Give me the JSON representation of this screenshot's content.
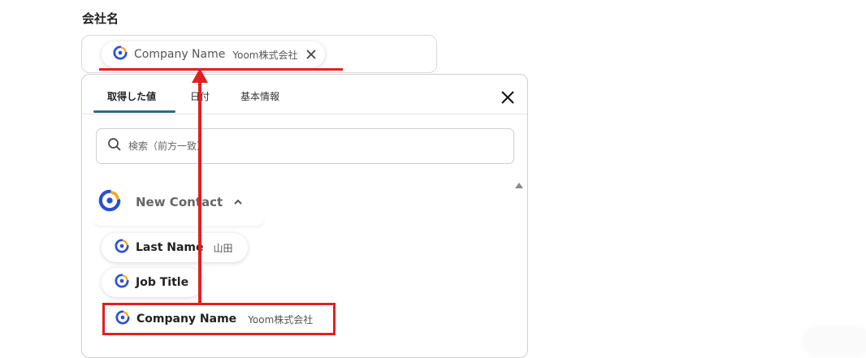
{
  "field": {
    "label": "会社名",
    "selected_chip": {
      "name": "Company Name",
      "value": "Yoom株式会社"
    }
  },
  "panel": {
    "tabs": [
      {
        "label": "取得した値",
        "active": true
      },
      {
        "label": "日付",
        "active": false
      },
      {
        "label": "基本情報",
        "active": false
      }
    ],
    "search_placeholder": "検索（前方一致）",
    "group": {
      "label": "New Contact",
      "expanded": true
    },
    "items": [
      {
        "name": "Last Name",
        "value": "山田"
      },
      {
        "name": "Job Title",
        "value": ""
      },
      {
        "name": "Company Name",
        "value": "Yoom株式会社"
      }
    ]
  },
  "colors": {
    "annotation_red": "#e02020",
    "tab_accent": "#2d6b80",
    "icon_blue": "#2a4fd6",
    "icon_orange": "#f5a623"
  },
  "icons": [
    "app-logo-icon",
    "close-icon",
    "search-icon",
    "chevron-up-icon"
  ]
}
